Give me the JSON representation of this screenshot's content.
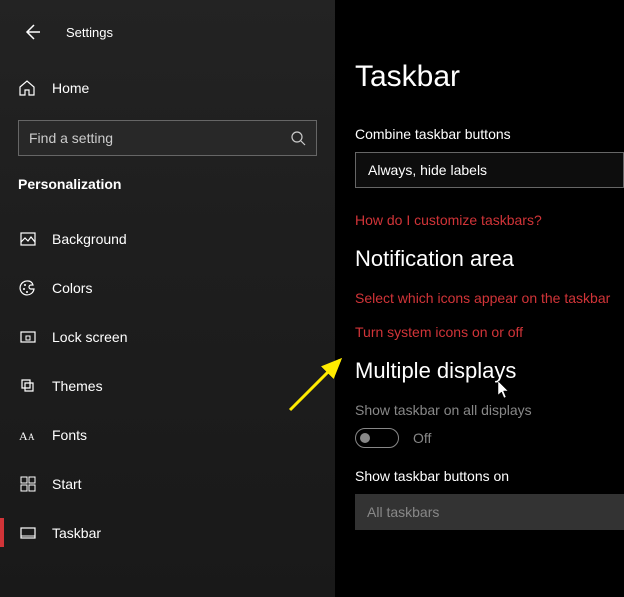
{
  "header": {
    "title": "Settings"
  },
  "sidebar": {
    "home_label": "Home",
    "search_placeholder": "Find a setting",
    "category": "Personalization",
    "items": [
      {
        "label": "Background"
      },
      {
        "label": "Colors"
      },
      {
        "label": "Lock screen"
      },
      {
        "label": "Themes"
      },
      {
        "label": "Fonts"
      },
      {
        "label": "Start"
      },
      {
        "label": "Taskbar"
      }
    ]
  },
  "content": {
    "page_title": "Taskbar",
    "combine_label": "Combine taskbar buttons",
    "combine_value": "Always, hide labels",
    "customize_link": "How do I customize taskbars?",
    "notification_title": "Notification area",
    "select_icons_link": "Select which icons appear on the taskbar",
    "system_icons_link": "Turn system icons on or off",
    "multiple_title": "Multiple displays",
    "show_taskbar_label": "Show taskbar on all displays",
    "toggle_state": "Off",
    "show_buttons_label": "Show taskbar buttons on",
    "show_buttons_value": "All taskbars"
  }
}
